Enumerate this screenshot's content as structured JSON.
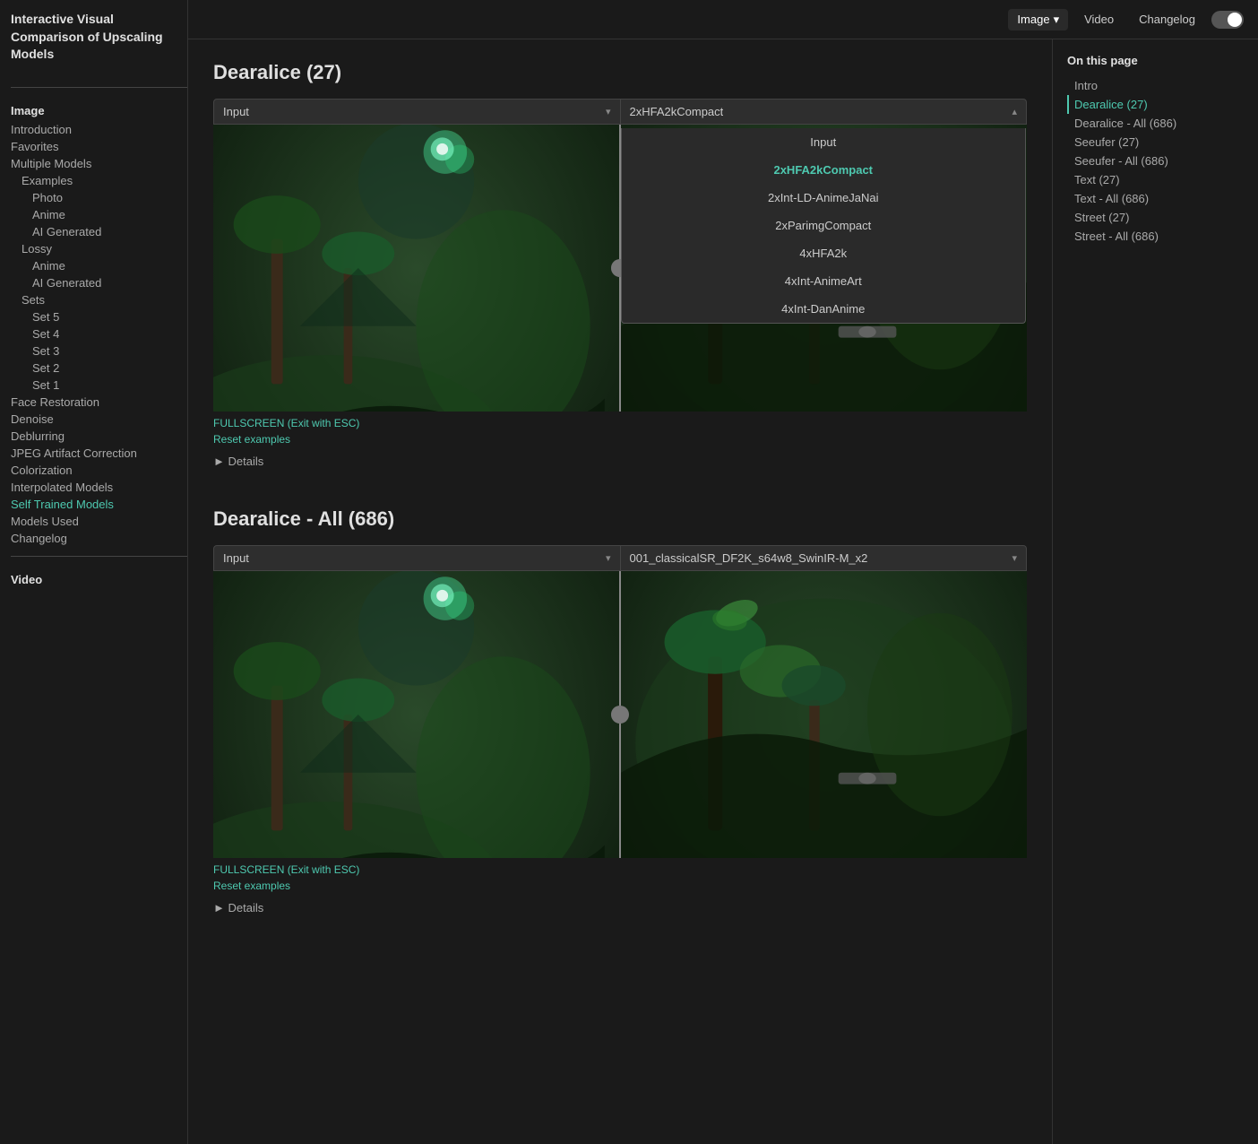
{
  "app": {
    "title": "Interactive Visual Comparison of Upscaling Models"
  },
  "topnav": {
    "image_label": "Image",
    "video_label": "Video",
    "changelog_label": "Changelog"
  },
  "sidebar": {
    "sections": [
      {
        "label": "Image",
        "items": [
          {
            "label": "Introduction",
            "indent": 0,
            "active": false
          },
          {
            "label": "Favorites",
            "indent": 0,
            "active": false
          },
          {
            "label": "Multiple Models",
            "indent": 0,
            "active": false
          },
          {
            "label": "Examples",
            "indent": 1,
            "active": false
          },
          {
            "label": "Photo",
            "indent": 2,
            "active": false
          },
          {
            "label": "Anime",
            "indent": 2,
            "active": false
          },
          {
            "label": "AI Generated",
            "indent": 2,
            "active": false
          },
          {
            "label": "Lossy",
            "indent": 1,
            "active": false
          },
          {
            "label": "Anime",
            "indent": 2,
            "active": false
          },
          {
            "label": "AI Generated",
            "indent": 2,
            "active": false
          },
          {
            "label": "Sets",
            "indent": 1,
            "active": false
          },
          {
            "label": "Set 5",
            "indent": 2,
            "active": false
          },
          {
            "label": "Set 4",
            "indent": 2,
            "active": false
          },
          {
            "label": "Set 3",
            "indent": 2,
            "active": false
          },
          {
            "label": "Set 2",
            "indent": 2,
            "active": false
          },
          {
            "label": "Set 1",
            "indent": 2,
            "active": false
          },
          {
            "label": "Face Restoration",
            "indent": 0,
            "active": false
          },
          {
            "label": "Denoise",
            "indent": 0,
            "active": false
          },
          {
            "label": "Deblurring",
            "indent": 0,
            "active": false
          },
          {
            "label": "JPEG Artifact Correction",
            "indent": 0,
            "active": false
          },
          {
            "label": "Colorization",
            "indent": 0,
            "active": false
          },
          {
            "label": "Interpolated Models",
            "indent": 0,
            "active": false
          },
          {
            "label": "Self Trained Models",
            "indent": 0,
            "active": true
          },
          {
            "label": "Models Used",
            "indent": 0,
            "active": false
          },
          {
            "label": "Changelog",
            "indent": 0,
            "active": false
          }
        ]
      },
      {
        "label": "Video",
        "items": []
      }
    ]
  },
  "toc": {
    "title": "On this page",
    "items": [
      {
        "label": "Intro",
        "active": false
      },
      {
        "label": "Dearalice (27)",
        "active": true
      },
      {
        "label": "Dearalice - All (686)",
        "active": false
      },
      {
        "label": "Seeufer (27)",
        "active": false
      },
      {
        "label": "Seeufer - All (686)",
        "active": false
      },
      {
        "label": "Text (27)",
        "active": false
      },
      {
        "label": "Text - All (686)",
        "active": false
      },
      {
        "label": "Street (27)",
        "active": false
      },
      {
        "label": "Street - All (686)",
        "active": false
      }
    ]
  },
  "sections": [
    {
      "id": "dearalice-27",
      "title": "Dearalice (27)",
      "left_dropdown": {
        "label": "Input",
        "options": [
          "Input"
        ]
      },
      "right_dropdown": {
        "label": "2xHFA2kCompact",
        "options": [
          "Input",
          "2xHFA2kCompact",
          "2xInt-LD-AnimeJaNai",
          "2xParimgCompact",
          "4xHFA2k",
          "4xInt-AnimeArt",
          "4xInt-DanAnime"
        ],
        "selected": "2xHFA2kCompact",
        "open": true
      },
      "fullscreen_label": "FULLSCREEN (Exit with ESC)",
      "reset_label": "Reset examples",
      "details_label": "► Details"
    },
    {
      "id": "dearalice-all-686",
      "title": "Dearalice - All (686)",
      "left_dropdown": {
        "label": "Input",
        "options": [
          "Input"
        ]
      },
      "right_dropdown": {
        "label": "001_classicalSR_DF2K_s64w8_SwinIR-M_x2",
        "options": [
          "001_classicalSR_DF2K_s64w8_SwinIR-M_x2"
        ],
        "selected": "001_classicalSR_DF2K_s64w8_SwinIR-M_x2",
        "open": false
      },
      "fullscreen_label": "FULLSCREEN (Exit with ESC)",
      "reset_label": "Reset examples",
      "details_label": "► Details"
    }
  ]
}
